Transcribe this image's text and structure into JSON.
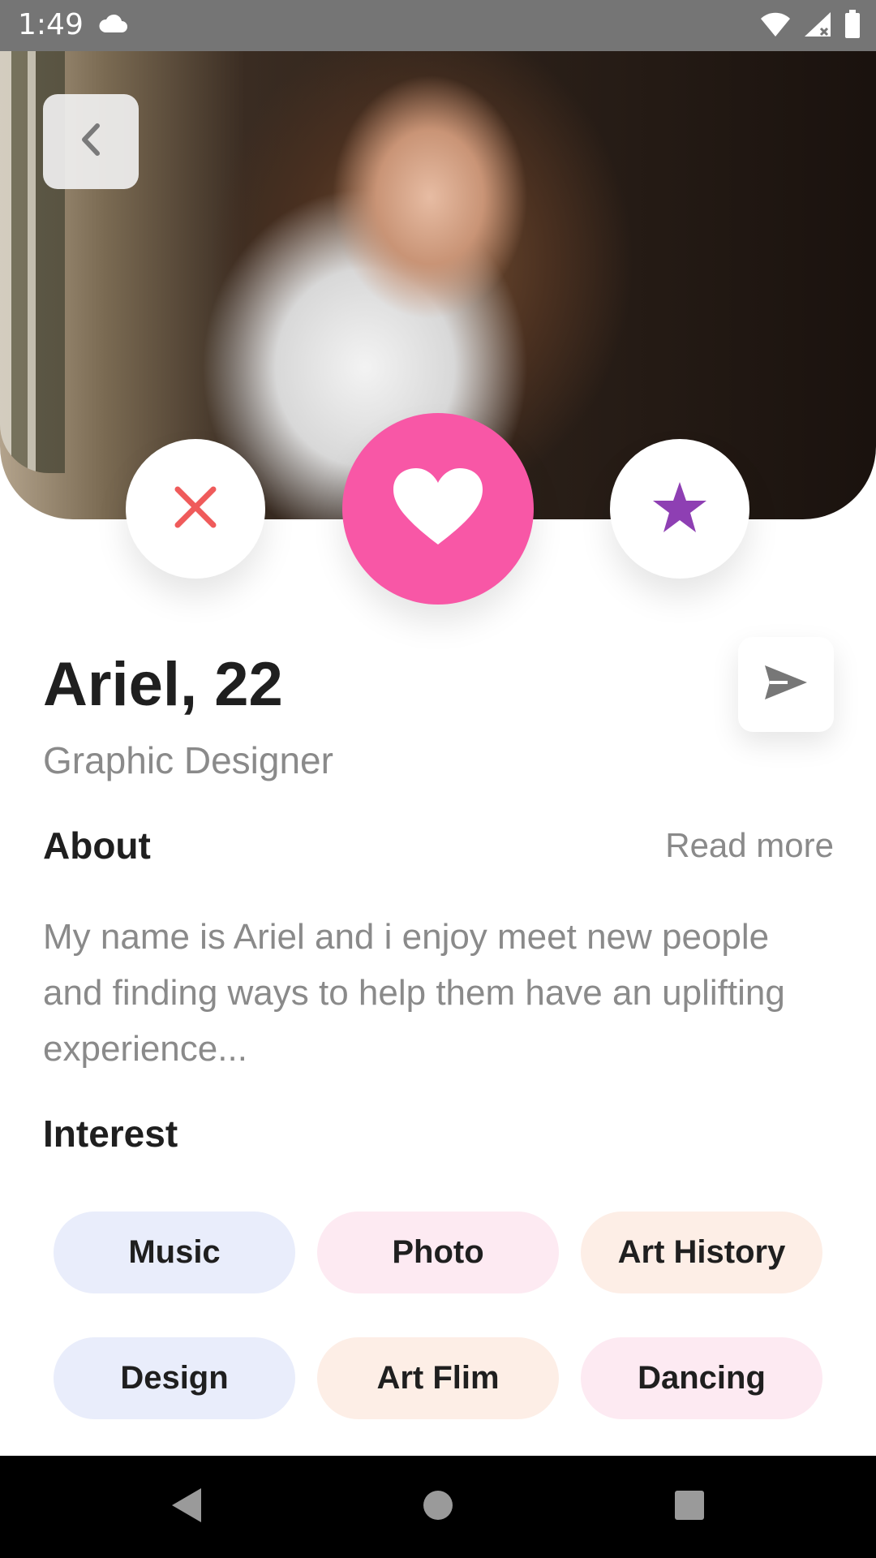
{
  "status_bar": {
    "time": "1:49",
    "icons": [
      "cloud-icon",
      "wifi-icon",
      "signal-icon",
      "battery-icon"
    ]
  },
  "profile": {
    "name_age": "Ariel, 22",
    "job_title": "Graphic Designer"
  },
  "about": {
    "title": "About",
    "read_more": "Read more",
    "text": "My name is Ariel and i enjoy meet new people and finding ways to help them have an uplifting experience..."
  },
  "interests": {
    "title": "Interest",
    "items": [
      {
        "label": "Music",
        "color": "#e9edfb"
      },
      {
        "label": "Photo",
        "color": "#fdeaf2"
      },
      {
        "label": "Art History",
        "color": "#fdeee6"
      },
      {
        "label": "Design",
        "color": "#e9edfb"
      },
      {
        "label": "Art Flim",
        "color": "#fdeee6"
      },
      {
        "label": "Dancing",
        "color": "#fdeaf2"
      }
    ]
  },
  "actions": {
    "dislike_icon": "close-icon",
    "like_icon": "heart-icon",
    "superlike_icon": "star-icon",
    "send_icon": "send-icon",
    "back_icon": "chevron-left-icon"
  },
  "colors": {
    "like": "#f857a6",
    "dislike": "#ef5b5b",
    "star": "#8e3fb3"
  },
  "nav": {
    "icons": [
      "back-triangle-icon",
      "home-circle-icon",
      "recents-square-icon"
    ]
  }
}
